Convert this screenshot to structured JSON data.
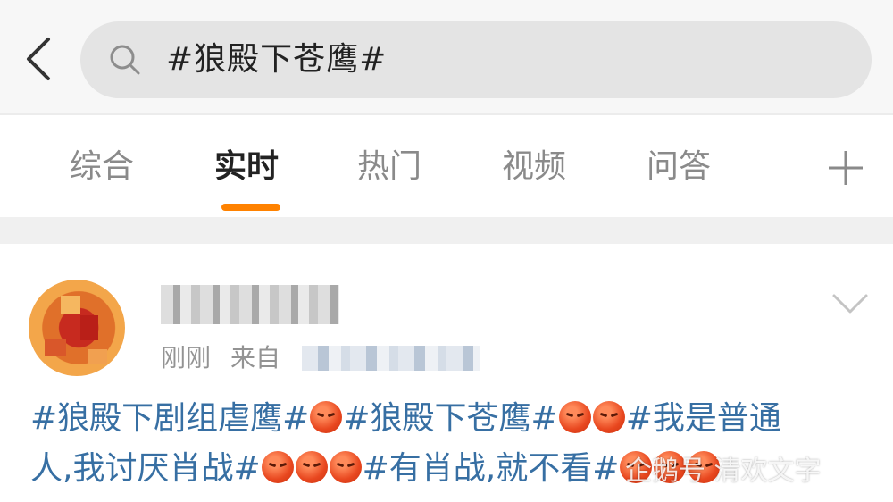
{
  "header": {
    "back_icon": "chevron-left-icon",
    "search_icon": "search-icon",
    "search_query": "#狼殿下苍鹰#"
  },
  "tabs": [
    {
      "label": "综合",
      "active": false
    },
    {
      "label": "实时",
      "active": true
    },
    {
      "label": "热门",
      "active": false
    },
    {
      "label": "视频",
      "active": false
    },
    {
      "label": "问答",
      "active": false
    }
  ],
  "tab_more_icon": "plus-icon",
  "accent_color": "#ff8200",
  "link_color": "#376fa3",
  "post": {
    "time": "刚刚",
    "source_prefix": "来自",
    "more_icon": "chevron-down-icon",
    "line1_parts": {
      "tag1": "#狼殿下剧组虐鹰#",
      "tag2": "#狼殿下苍鹰#",
      "tag3_start": "#我是普通"
    },
    "line2_parts": {
      "tag3_end": "人,我讨厌肖战#",
      "tag4": "#有肖战,就不看#"
    }
  },
  "watermark": "企鹅号 清欢文字"
}
